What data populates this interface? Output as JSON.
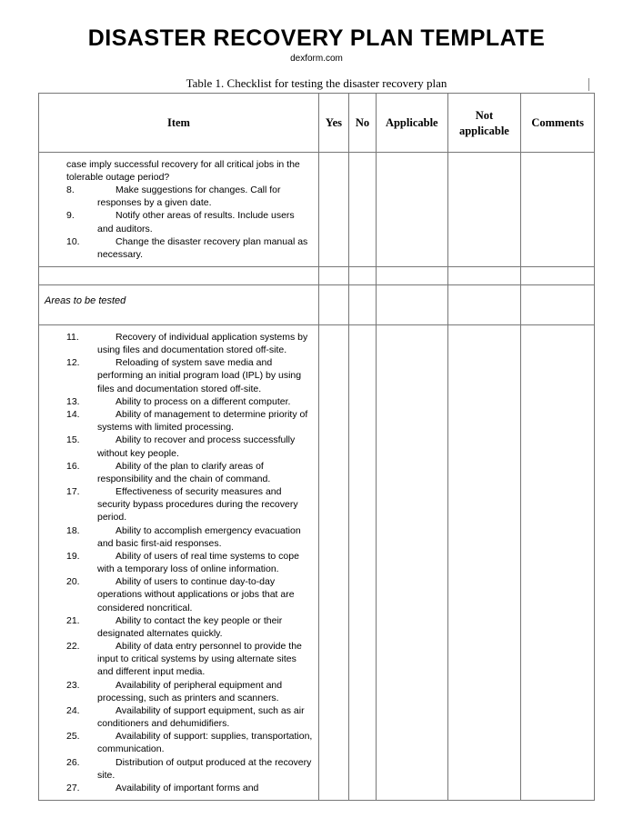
{
  "header": {
    "title": "DISASTER RECOVERY PLAN TEMPLATE",
    "subtitle": "dexform.com",
    "caption": "Table 1. Checklist for testing the disaster recovery plan"
  },
  "columns": {
    "item": "Item",
    "yes": "Yes",
    "no": "No",
    "applicable": "Applicable",
    "not_applicable": "Not applicable",
    "comments": "Comments"
  },
  "continuation": "case imply successful recovery for all critical jobs in the tolerable outage period?",
  "block1": [
    {
      "num": "8.",
      "text": "Make suggestions for changes. Call for responses by a given date."
    },
    {
      "num": "9.",
      "text": "Notify other areas of results. Include users and auditors."
    },
    {
      "num": "10.",
      "text": "Change the disaster recovery plan manual as necessary."
    }
  ],
  "section": "Areas to be tested",
  "block2": [
    {
      "num": "11.",
      "text": "Recovery of individual application systems by using files and documentation stored off-site."
    },
    {
      "num": "12.",
      "text": "Reloading of system save media and performing an initial program load (IPL) by using files and documentation stored off-site."
    },
    {
      "num": "13.",
      "text": "Ability to process on a different computer."
    },
    {
      "num": "14.",
      "text": "Ability of management to determine priority of systems with limited processing."
    },
    {
      "num": "15.",
      "text": "Ability to recover and process successfully without key people."
    },
    {
      "num": "16.",
      "text": "Ability of the plan to clarify areas of responsibility and the chain of command."
    },
    {
      "num": "17.",
      "text": "Effectiveness of security measures and security bypass procedures during the recovery period."
    },
    {
      "num": "18.",
      "text": "Ability to accomplish emergency evacuation and basic first-aid responses."
    },
    {
      "num": "19.",
      "text": "Ability of users of real time systems to cope with a temporary loss of online information."
    },
    {
      "num": "20.",
      "text": "Ability of users to continue day-to-day operations without applications or jobs that are considered noncritical."
    },
    {
      "num": "21.",
      "text": "Ability to contact the key people or their designated alternates quickly."
    },
    {
      "num": "22.",
      "text": "Ability of data entry personnel to provide the input to critical systems by using alternate sites and different input media."
    },
    {
      "num": "23.",
      "text": "Availability of peripheral equipment and processing, such as printers and scanners."
    },
    {
      "num": "24.",
      "text": "Availability of support equipment, such as air conditioners and dehumidifiers."
    },
    {
      "num": "25.",
      "text": "Availability of support: supplies, transportation, communication."
    },
    {
      "num": "26.",
      "text": "Distribution of output produced at the recovery site."
    },
    {
      "num": "27.",
      "text": "Availability of important forms and"
    }
  ]
}
